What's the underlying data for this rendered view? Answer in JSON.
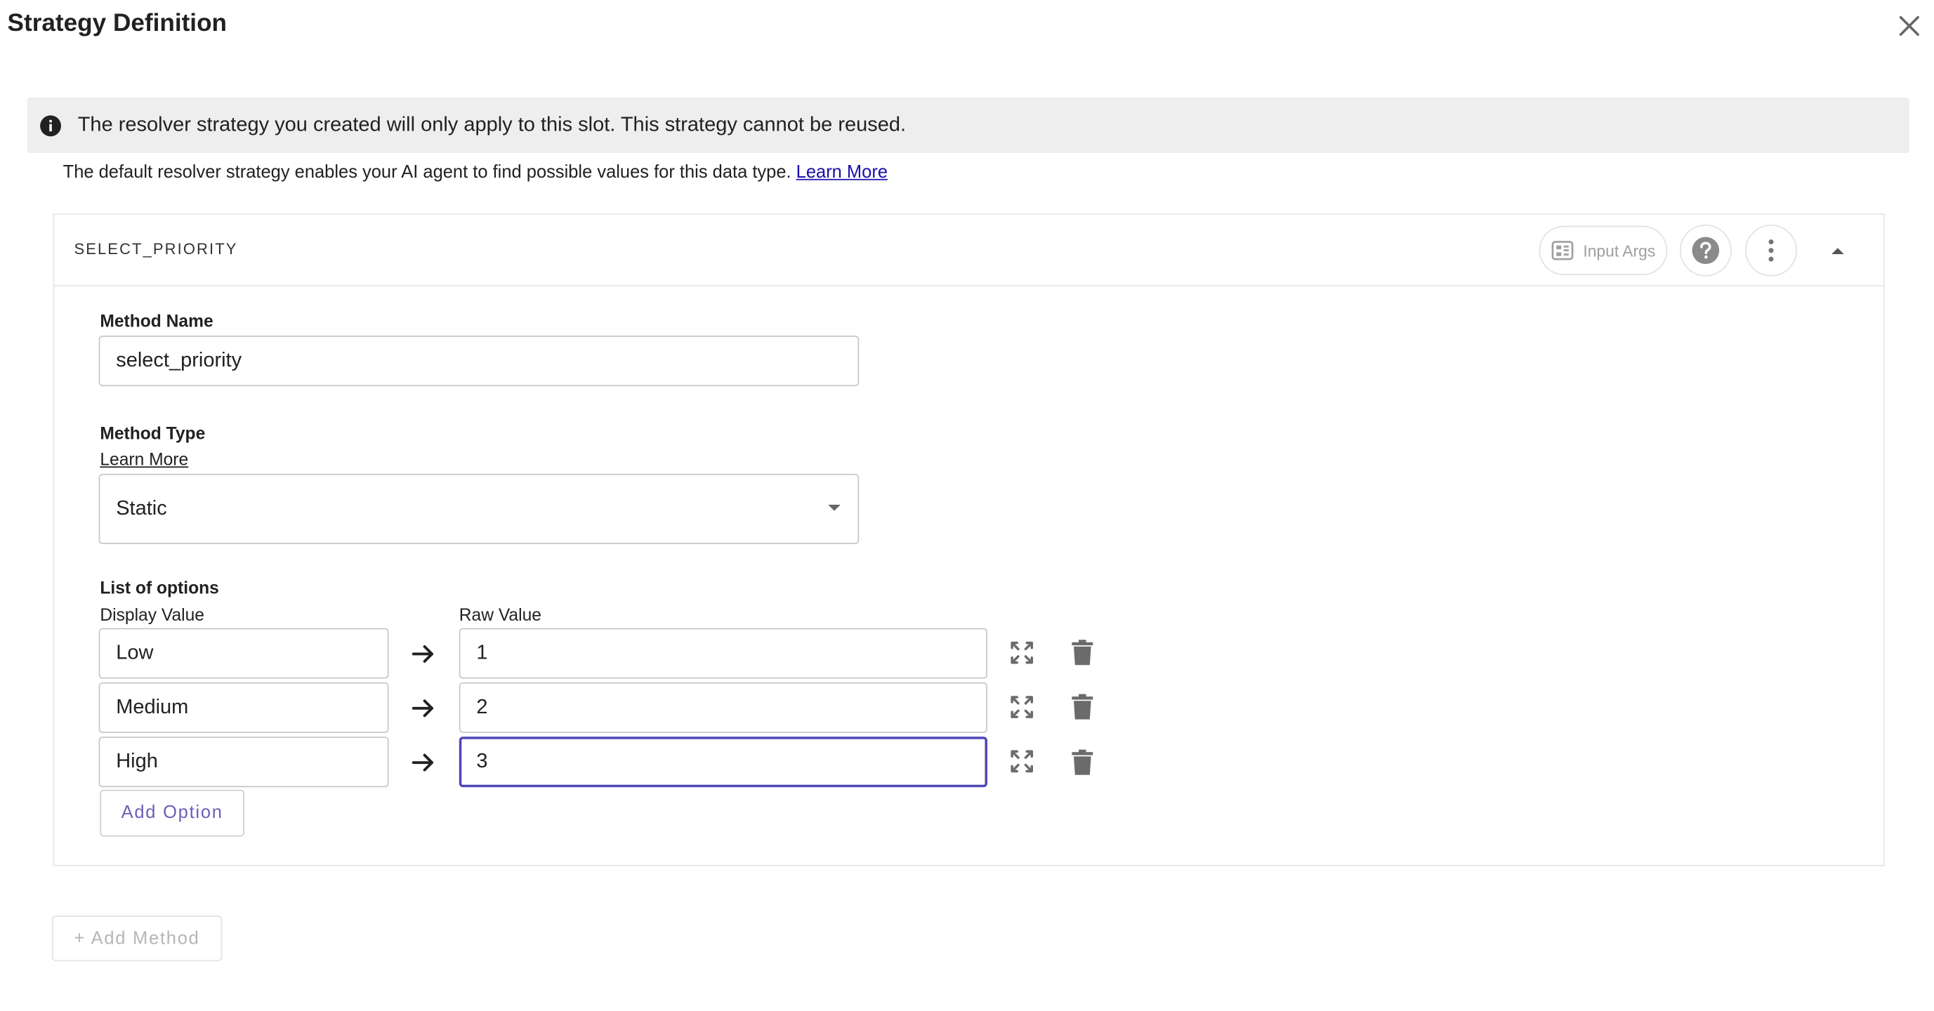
{
  "dialog": {
    "title": "Strategy Definition"
  },
  "banner": {
    "text": "The resolver strategy you created will only apply to this slot. This strategy cannot be reused."
  },
  "description": {
    "text": "The default resolver strategy enables your AI agent to find possible values for this data type.",
    "link": "Learn More"
  },
  "method": {
    "key": "SELECT_PRIORITY",
    "input_args_label": "Input Args",
    "name_label": "Method Name",
    "name_value": "select_priority",
    "type_label": "Method Type",
    "type_learn_more": "Learn More",
    "type_value": "Static",
    "options_label": "List of options",
    "display_value_label": "Display Value",
    "raw_value_label": "Raw Value",
    "options": [
      {
        "display": "Low",
        "raw": "1"
      },
      {
        "display": "Medium",
        "raw": "2"
      },
      {
        "display": "High",
        "raw": "3"
      }
    ],
    "add_option_label": "Add Option"
  },
  "footer": {
    "add_method_label": "+ Add Method"
  },
  "icons": {
    "close": "close-icon",
    "info": "info-icon",
    "input_args": "input-args-icon",
    "help": "help-icon",
    "more": "more-vertical-icon",
    "collapse": "chevron-up-icon",
    "arrow": "arrow-right-icon",
    "expand": "expand-icon",
    "delete": "trash-icon"
  },
  "colors": {
    "accent": "#5046b5",
    "banner_bg": "#eeeeee",
    "link": "#1a0dab",
    "icon": "#6b6b6b"
  }
}
